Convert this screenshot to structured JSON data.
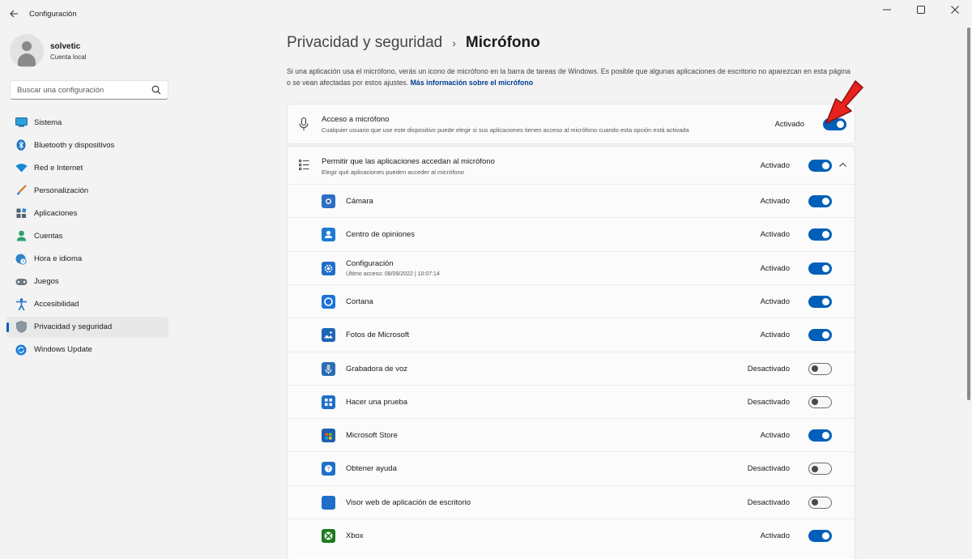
{
  "window": {
    "title": "Configuración",
    "back_icon": "back-arrow-icon",
    "controls": [
      "minimize-icon",
      "maximize-icon",
      "close-icon"
    ]
  },
  "profile": {
    "name": "solvetic",
    "subtitle": "Cuenta local"
  },
  "search": {
    "placeholder": "Buscar una configuración",
    "icon": "search-icon"
  },
  "sidebar": {
    "items": [
      {
        "label": "Sistema",
        "icon": "system-icon",
        "active": false
      },
      {
        "label": "Bluetooth y dispositivos",
        "icon": "bluetooth-icon",
        "active": false
      },
      {
        "label": "Red e Internet",
        "icon": "wifi-icon",
        "active": false
      },
      {
        "label": "Personalización",
        "icon": "brush-icon",
        "active": false
      },
      {
        "label": "Aplicaciones",
        "icon": "apps-icon",
        "active": false
      },
      {
        "label": "Cuentas",
        "icon": "account-icon",
        "active": false
      },
      {
        "label": "Hora e idioma",
        "icon": "globe-clock-icon",
        "active": false
      },
      {
        "label": "Juegos",
        "icon": "gamepad-icon",
        "active": false
      },
      {
        "label": "Accesibilidad",
        "icon": "accessibility-icon",
        "active": false
      },
      {
        "label": "Privacidad y seguridad",
        "icon": "shield-icon",
        "active": true
      },
      {
        "label": "Windows Update",
        "icon": "update-icon",
        "active": false
      }
    ]
  },
  "header": {
    "parent": "Privacidad y seguridad",
    "separator": "›",
    "current": "Micrófono"
  },
  "description": {
    "text": "Si una aplicación usa el micrófono, verás un icono de micrófono en la barra de tareas de Windows. Es posible que algunas aplicaciones de escritorio no aparezcan en esta página o se vean afectadas por estos ajustes.",
    "link": "Más información sobre el micrófono"
  },
  "mic_access": {
    "title": "Acceso a micrófono",
    "subtitle": "Cualquier usuario que use este dispositivo puede elegir si sus aplicaciones tienen acceso al micrófono cuando esta opción está activada",
    "status": "Activado",
    "on": true,
    "icon": "microphone-icon"
  },
  "app_access": {
    "title": "Permitir que las aplicaciones accedan al micrófono",
    "subtitle": "Elegir qué aplicaciones pueden acceder al micrófono",
    "status": "Activado",
    "on": true,
    "icon": "list-icon",
    "expand_icon": "chevron-up-icon"
  },
  "apps": [
    {
      "name": "Cámara",
      "sub": "",
      "status": "Activado",
      "on": true,
      "icon": "camera-app-icon",
      "color": "#2f6fc4"
    },
    {
      "name": "Centro de opiniones",
      "sub": "",
      "status": "Activado",
      "on": true,
      "icon": "feedback-hub-icon",
      "color": "#1f7ad6"
    },
    {
      "name": "Configuración",
      "sub": "Último acceso: 08/09/2022  |  10:07:14",
      "status": "Activado",
      "on": true,
      "icon": "settings-app-icon",
      "color": "#1f6fc8"
    },
    {
      "name": "Cortana",
      "sub": "",
      "status": "Activado",
      "on": true,
      "icon": "cortana-icon",
      "color": "#1a73d9"
    },
    {
      "name": "Fotos de Microsoft",
      "sub": "",
      "status": "Activado",
      "on": true,
      "icon": "photos-icon",
      "color": "#1e64b8"
    },
    {
      "name": "Grabadora de voz",
      "sub": "",
      "status": "Desactivado",
      "on": false,
      "icon": "voice-recorder-icon",
      "color": "#2b6cb4"
    },
    {
      "name": "Hacer una prueba",
      "sub": "",
      "status": "Desactivado",
      "on": false,
      "icon": "quiz-icon",
      "color": "#1f6fc8"
    },
    {
      "name": "Microsoft Store",
      "sub": "",
      "status": "Activado",
      "on": true,
      "icon": "store-icon",
      "color": "#1d5fae"
    },
    {
      "name": "Obtener ayuda",
      "sub": "",
      "status": "Desactivado",
      "on": false,
      "icon": "help-icon",
      "color": "#1f6fc8"
    },
    {
      "name": "Visor web de aplicación de escritorio",
      "sub": "",
      "status": "Desactivado",
      "on": false,
      "icon": "webview-icon",
      "color": "#1f6fc8"
    },
    {
      "name": "Xbox",
      "sub": "",
      "status": "Activado",
      "on": true,
      "icon": "xbox-icon",
      "color": "#1c7a1c"
    }
  ],
  "colors": {
    "accent": "#005fb8",
    "annotation_arrow": "#e8221d"
  }
}
